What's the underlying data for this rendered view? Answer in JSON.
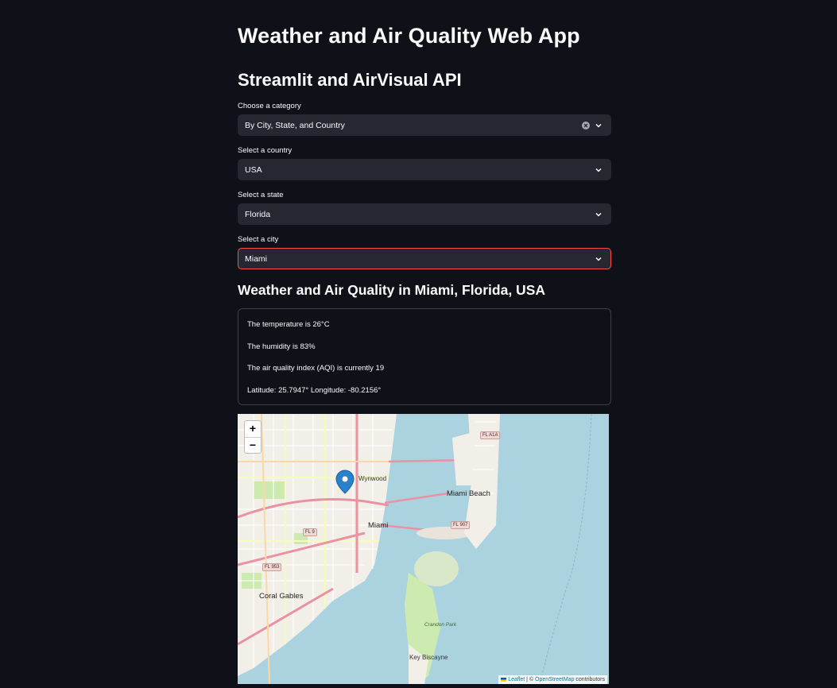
{
  "header": {
    "title": "Weather and Air Quality Web App",
    "subtitle": "Streamlit and AirVisual API"
  },
  "form": {
    "category": {
      "label": "Choose a category",
      "value": "By City, State, and Country"
    },
    "country": {
      "label": "Select a country",
      "value": "USA"
    },
    "state": {
      "label": "Select a state",
      "value": "Florida"
    },
    "city": {
      "label": "Select a city",
      "value": "Miami"
    }
  },
  "results": {
    "title": "Weather and Air Quality in Miami, Florida, USA",
    "temperature": "The temperature is 26°C",
    "humidity": "The humidity is 83%",
    "aqi": "The air quality index (AQI) is currently 19",
    "coordinates": "Latitude: 25.7947° Longitude: -80.2156°"
  },
  "map": {
    "zoom_in": "+",
    "zoom_out": "−",
    "labels": {
      "wynwood": "Wynwood",
      "miami": "Miami",
      "miami_beach": "Miami Beach",
      "coral_gables": "Coral Gables",
      "key_biscayne": "Key Biscayne",
      "crandon_park": "Crandon Park"
    },
    "highways": {
      "fl_a1a": "FL A1A",
      "fl_907": "FL 907",
      "fl_9": "FL 9",
      "fl_953": "FL 953"
    },
    "attribution": {
      "leaflet": "Leaflet",
      "separator": " | © ",
      "osm": "OpenStreetMap",
      "contributors": " contributors"
    }
  },
  "colors": {
    "background": "#0e1117",
    "input_bg": "#262730",
    "focus_border": "#ff4b4b",
    "water": "#aad3df",
    "marker": "#2a81cb"
  }
}
